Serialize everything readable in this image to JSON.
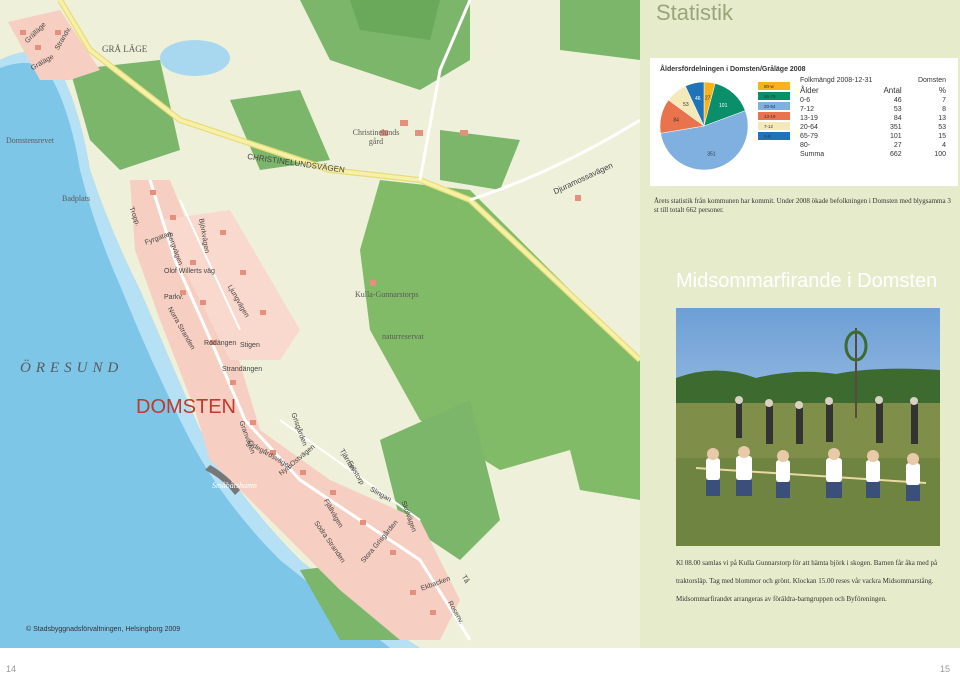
{
  "map": {
    "region_grale": "GRÅ LÄGE",
    "place_domstensrevet": "Domstensrevet",
    "place_christinelund": "Christinelunds\ngård",
    "road_christinelund": "CHRISTINELUNDSVÄGEN",
    "road_djuramossa": "Djuramossavägen",
    "place_badplats": "Badplats",
    "place_kulla": "Kulla-Gunnarstorps",
    "place_naturreservat": "naturreservat",
    "sea_oresund": "ÖRESUND",
    "village_domsten": "DOMSTEN",
    "place_smabatshamn": "Småbåtshamn",
    "copyright": "© Stadsbyggnadsförvaltningen, Helsingborg 2009",
    "streets": [
      "Grälläge",
      "Strandv.",
      "Gräläge",
      "Tropp.",
      "Fyrgatan",
      "Bergvägen",
      "Olof Willerts väg",
      "Parkv.",
      "Norra Stranden",
      "Ljungvägen",
      "Björkvägen",
      "Rödängen",
      "Stigen",
      "Strandängen",
      "Granvägen",
      "Grisgården",
      "Nya Ostvägen",
      "Ödegårdsvägen",
      "Tjärnan",
      "Fjällvägen",
      "Södra Stranden",
      "Skolvägen",
      "Stora Grisgården",
      "Slingan",
      "Ekbacken",
      "Fröstorp",
      "Tå",
      "Rosenv."
    ]
  },
  "stats": {
    "heading": "Statistik",
    "chart_title": "Åldersfördelningen i Domsten/Gråläge 2008",
    "table": {
      "title": "Folkmängd 2008-12-31",
      "place": "Domsten",
      "headers": [
        "Ålder",
        "Antal",
        "%"
      ],
      "rows": [
        [
          "0-6",
          "46",
          "7"
        ],
        [
          "7-12",
          "53",
          "8"
        ],
        [
          "13-19",
          "84",
          "13"
        ],
        [
          "20-64",
          "351",
          "53"
        ],
        [
          "65-79",
          "101",
          "15"
        ],
        [
          "80-",
          "27",
          "4"
        ],
        [
          "Summa",
          "662",
          "100"
        ]
      ]
    },
    "text": "Årets statistik från kommunen har kommit. Under 2008 ökade befolkningen i Domsten med blygsamma 3 st till totalt 662 personer."
  },
  "chart_data": {
    "type": "pie",
    "title": "Åldersfördelningen i Domsten/Gråläge 2008",
    "categories": [
      "80-w",
      "65-79",
      "20-64",
      "13-19",
      "7-12",
      "0-6"
    ],
    "values": [
      27,
      101,
      351,
      84,
      53,
      46
    ],
    "colors": [
      "#f7b21c",
      "#0b8f6a",
      "#7fb0e0",
      "#e9734c",
      "#f4e9b9",
      "#1f74b8"
    ]
  },
  "midsommar": {
    "heading": "Midsommarfirande i Domsten",
    "text": "Kl 08.00 samlas vi på Kulla Gunnarstorp för att hämta björk i skogen. Barnen får åka med på traktorsläp. Tag med blommor och grönt. Klockan 15.00 reses vår vackra Midsommarstång. Midsommarfirandet arrangeras av föräldra-barngruppen och Byföreningen."
  },
  "pages": {
    "left": "14",
    "right": "15"
  }
}
